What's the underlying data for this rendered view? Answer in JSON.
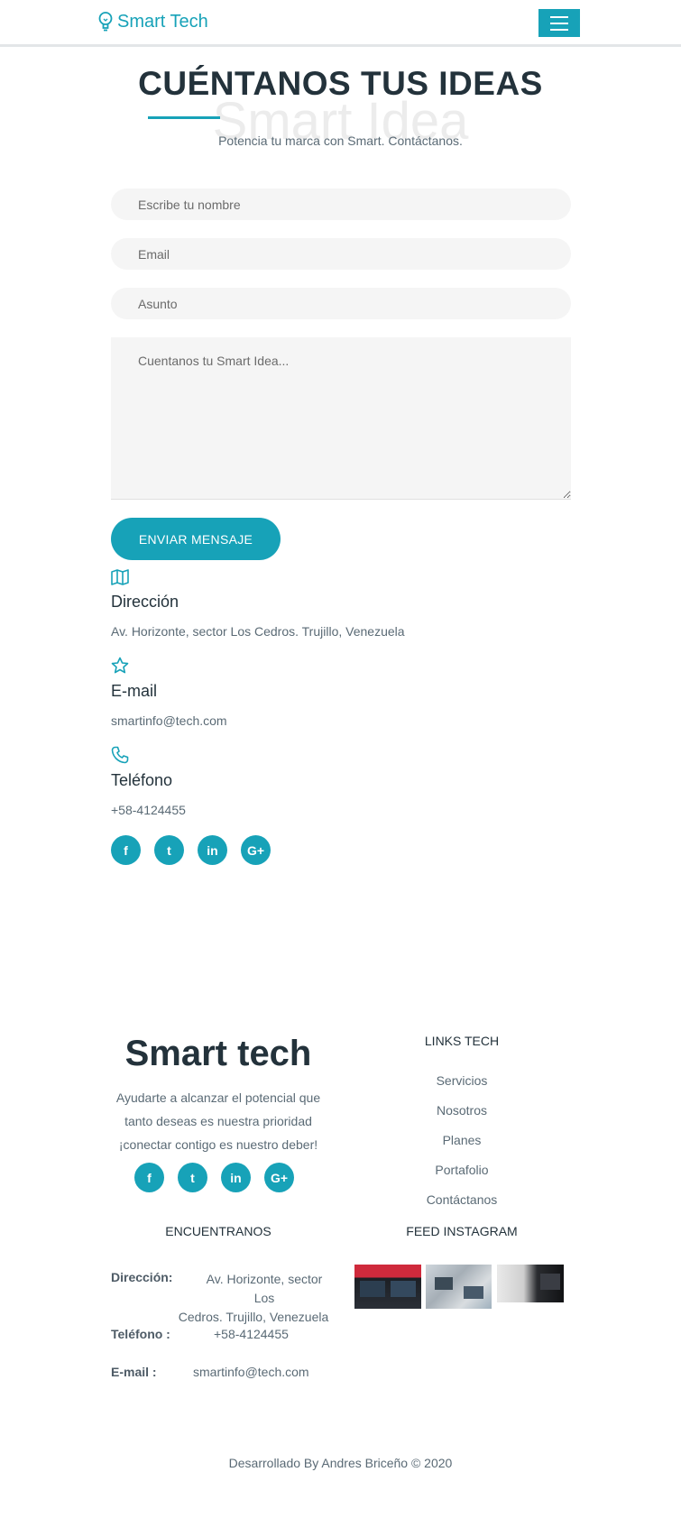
{
  "navbar": {
    "brand": "Smart Tech",
    "brand_icon": "lightbulb-icon",
    "menu_icon": "hamburger-icon"
  },
  "hero": {
    "title": "CUÉNTANOS TUS IDEAS",
    "ghost_text": "Smart Idea",
    "subtitle": "Potencia tu marca con Smart. Contáctanos."
  },
  "form": {
    "name_placeholder": "Escribe tu nombre",
    "email_placeholder": "Email",
    "subject_placeholder": "Asunto",
    "message_placeholder": "Cuentanos tu Smart Idea...",
    "submit_label": "ENVIAR MENSAJE"
  },
  "contact": {
    "address": {
      "icon": "map-icon",
      "title": "Dirección",
      "text": "Av. Horizonte, sector Los Cedros. Trujillo, Venezuela"
    },
    "email": {
      "icon": "star-icon",
      "title": "E-mail",
      "text": "smartinfo@tech.com"
    },
    "phone": {
      "icon": "phone-icon",
      "title": "Teléfono",
      "text": "+58-4124455"
    }
  },
  "social": [
    {
      "name": "facebook-icon",
      "glyph": "f"
    },
    {
      "name": "twitter-icon",
      "glyph": "t"
    },
    {
      "name": "linkedin-icon",
      "glyph": "in"
    },
    {
      "name": "google-plus-icon",
      "glyph": "G+"
    }
  ],
  "footer": {
    "brand": "Smart tech",
    "about": "Ayudarte a alcanzar el potencial que tanto deseas es nuestra prioridad ¡conectar contigo es nuestro deber!",
    "links_title": "LINKS TECH",
    "links": [
      "Servicios",
      "Nosotros",
      "Planes",
      "Portafolio",
      "Contáctanos"
    ],
    "find_title": "ENCUENTRANOS",
    "find": {
      "address_label": "Dirección:",
      "address_line1": "Av. Horizonte, sector Los",
      "address_line2": "Cedros. Trujillo, Venezuela",
      "phone_label": "Teléfono :",
      "phone": "+58-4124455",
      "email_label": "E-mail :",
      "email": "smartinfo@tech.com"
    },
    "instagram_title": "FEED INSTAGRAM",
    "copyright": "Desarrollado By Andres Briceño © 2020"
  },
  "colors": {
    "accent": "#17a2b8",
    "heading": "#23323b",
    "text": "#5a6a75",
    "field_bg": "#f5f5f5"
  }
}
